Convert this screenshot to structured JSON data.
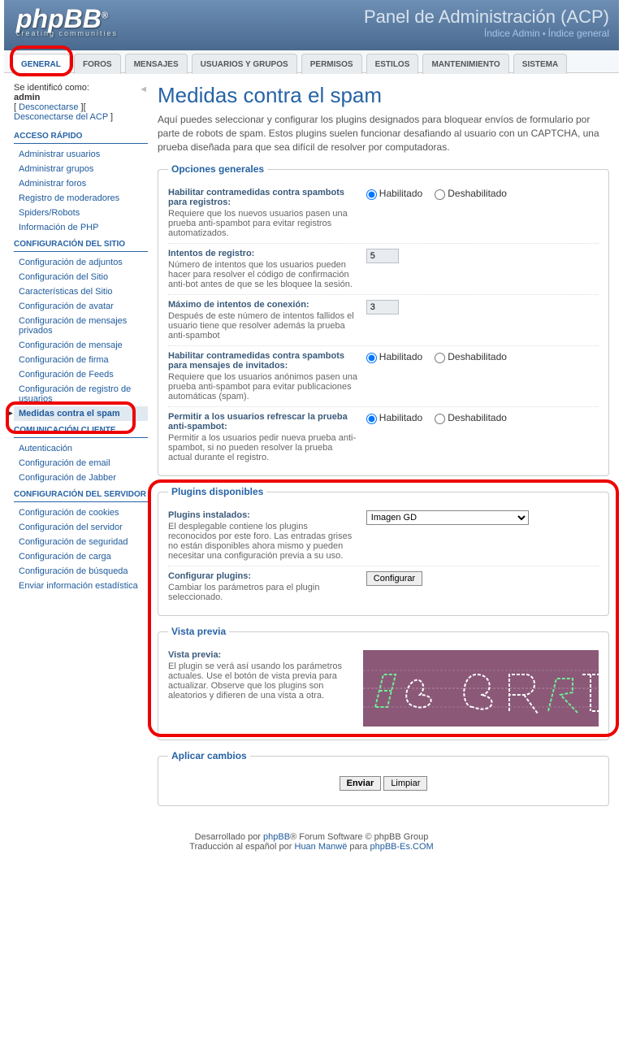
{
  "header": {
    "logo_text": "phpBB",
    "logo_sub": "creating communities",
    "title": "Panel de Administración (ACP)",
    "links": {
      "admin_index": "Índice Admin",
      "board_index": "Índice general"
    }
  },
  "tabs": [
    "GENERAL",
    "FOROS",
    "MENSAJES",
    "USUARIOS Y GRUPOS",
    "PERMISOS",
    "ESTILOS",
    "MANTENIMIENTO",
    "SISTEMA"
  ],
  "login": {
    "label": "Se identificó como:",
    "user": "admin",
    "logout": "Desconectarse",
    "logout_acp": "Desconectarse del ACP"
  },
  "sidebar": [
    {
      "title": "ACCESO RÁPIDO",
      "items": [
        "Administrar usuarios",
        "Administrar grupos",
        "Administrar foros",
        "Registro de moderadores",
        "Spiders/Robots",
        "Información de PHP"
      ]
    },
    {
      "title": "CONFIGURACIÓN DEL SITIO",
      "items": [
        "Configuración de adjuntos",
        "Configuración del Sitio",
        "Características del Sitio",
        "Configuración de avatar",
        "Configuración de mensajes privados",
        "Configuración de mensaje",
        "Configuración de firma",
        "Configuración de Feeds",
        "Configuración de registro de usuarios",
        "Medidas contra el spam"
      ],
      "active_index": 9
    },
    {
      "title": "COMUNICACIÓN CLIENTE",
      "items": [
        "Autenticación",
        "Configuración de email",
        "Configuración de Jabber"
      ]
    },
    {
      "title": "CONFIGURACIÓN DEL SERVIDOR",
      "items": [
        "Configuración de cookies",
        "Configuración del servidor",
        "Configuración de seguridad",
        "Configuración de carga",
        "Configuración de búsqueda",
        "Enviar información estadística"
      ]
    }
  ],
  "page": {
    "title": "Medidas contra el spam",
    "desc": "Aquí puedes seleccionar y configurar los plugins designados para bloquear envíos de formulario por parte de robots de spam. Estos plugins suelen funcionar desafiando al usuario con un CAPTCHA, una prueba diseñada para que sea difícil de resolver por computadoras."
  },
  "general": {
    "legend": "Opciones generales",
    "enable_reg": {
      "label": "Habilitar contramedidas contra spambots para registros:",
      "desc": "Requiere que los nuevos usuarios pasen una prueba anti-spambot para evitar registros automatizados."
    },
    "reg_attempts": {
      "label": "Intentos de registro:",
      "desc": "Número de intentos que los usuarios pueden hacer para resolver el código de confirmación anti-bot antes de que se les bloquee la sesión.",
      "value": "5"
    },
    "max_login": {
      "label": "Máximo de intentos de conexión:",
      "desc": "Después de este número de intentos fallidos el usuario tiene que resolver además la prueba anti-spambot",
      "value": "3"
    },
    "enable_guest": {
      "label": "Habilitar contramedidas contra spambots para mensajes de invitados:",
      "desc": "Requiere que los usuarios anónimos pasen una prueba anti-spambot para evitar publicaciones automáticas (spam)."
    },
    "allow_refresh": {
      "label": "Permitir a los usuarios refrescar la prueba anti-spambot:",
      "desc": "Permitir a los usuarios pedir nueva prueba anti-spambot, si no pueden resolver la prueba actual durante el registro."
    },
    "enabled": "Habilitado",
    "disabled": "Deshabilitado"
  },
  "plugins": {
    "legend": "Plugins disponibles",
    "installed": {
      "label": "Plugins instalados:",
      "desc": "El desplegable contiene los plugins reconocidos por este foro. Las entradas grises no están disponibles ahora mismo y pueden necesitar una configuración previa a su uso.",
      "value": "Imagen GD"
    },
    "configure": {
      "label": "Configurar plugins:",
      "desc": "Cambiar los parámetros para el plugin seleccionado.",
      "button": "Configurar"
    }
  },
  "preview": {
    "legend": "Vista previa",
    "label": "Vista previa:",
    "desc": "El plugin se verá así usando los parámetros actuales. Use el botón de vista previa para actualizar. Observe que los plugins son aleatorios y difieren de una vista a otra."
  },
  "apply": {
    "legend": "Aplicar cambios",
    "submit": "Enviar",
    "reset": "Limpiar"
  },
  "footer": {
    "line1a": "Desarrollado por ",
    "phpbb": "phpBB",
    "line1b": "® Forum Software © phpBB Group",
    "line2a": "Traducción al español por ",
    "translator": "Huan Manwë",
    "line2b": " para ",
    "site": "phpBB-Es.COM"
  }
}
